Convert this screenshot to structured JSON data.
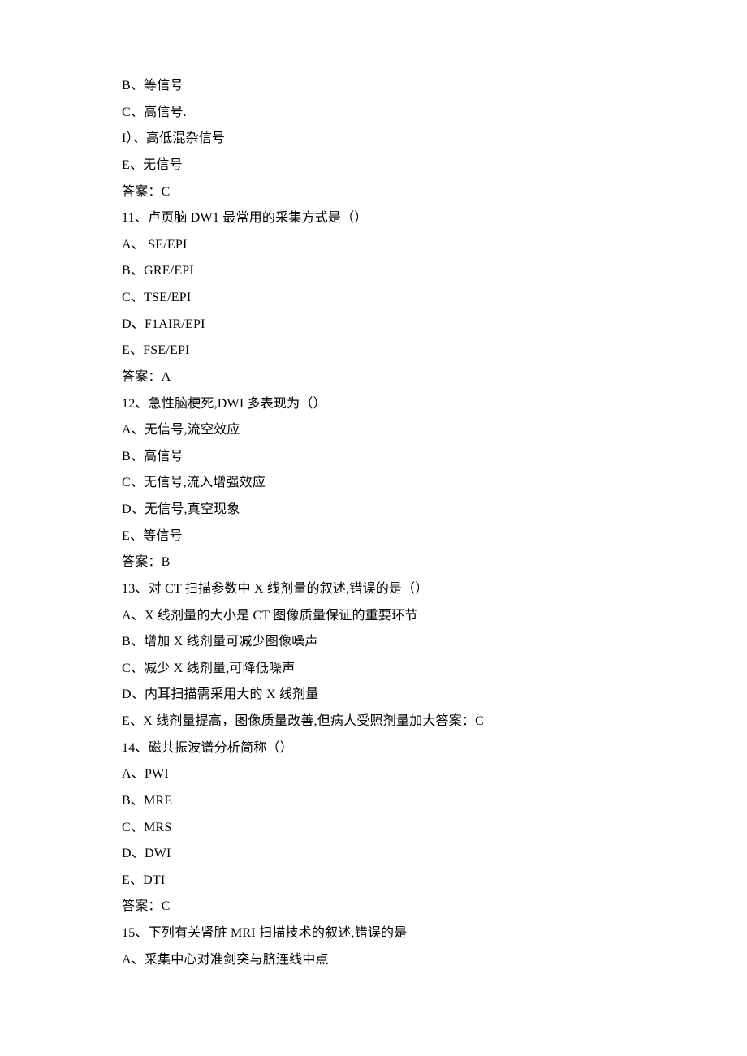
{
  "lines": [
    "B、等信号",
    "C、高信号.",
    "I）、高低混杂信号",
    "E、无信号",
    "答案：C",
    "11、卢页脑 DW1 最常用的采集方式是（）",
    "A、 SE/EPI",
    "B、GRE/EPI",
    "C、TSE/EPI",
    "D、F1AIR/EPI",
    "E、FSE/EPI",
    "答案：A",
    "12、急性脑梗死,DWI 多表现为（）",
    "A、无信号,流空效应",
    "B、高信号",
    "C、无信号,流入增强效应",
    "D、无信号,真空现象",
    "E、等信号",
    "答案：B",
    "13、对 CT 扫描参数中 X 线剂量的叙述,错误的是（）",
    "A、X 线剂量的大小是 CT 图像质量保证的重要环节",
    "B、增加 X 线剂量可减少图像噪声",
    "C、减少 X 线剂量,可降低噪声",
    "D、内耳扫描需采用大的 X 线剂量",
    "E、X 线剂量提高，图像质量改善,但病人受照剂量加大答案：C",
    "14、磁共振波谱分析简称（）",
    "A、PWI",
    "B、MRE",
    "C、MRS",
    "D、DWI",
    "E、DTI",
    "答案：C",
    "15、下列有关肾脏 MRI 扫描技术的叙述,错误的是",
    "A、采集中心对准剑突与脐连线中点"
  ]
}
